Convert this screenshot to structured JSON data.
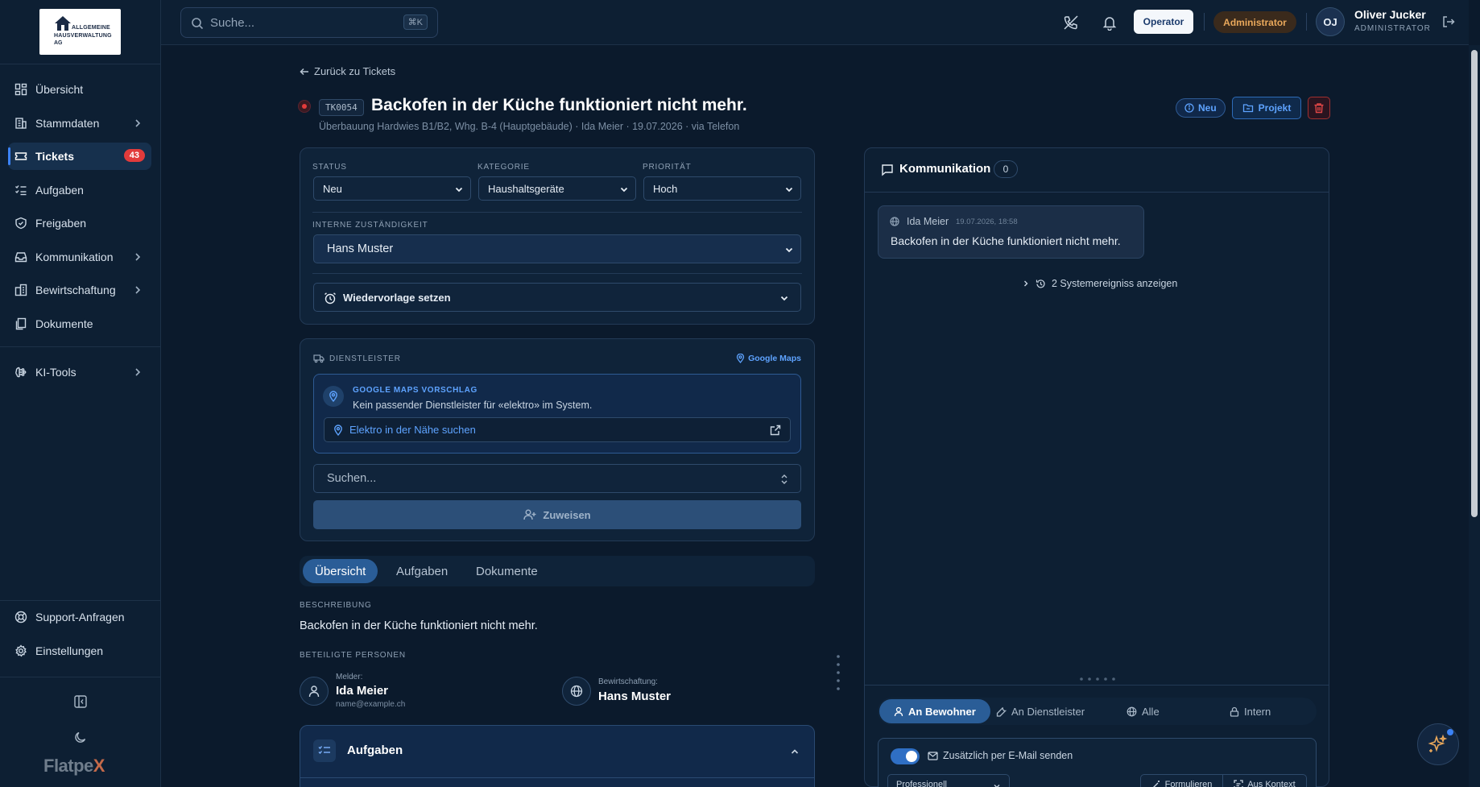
{
  "logo": {
    "line1": "ALLGEMEINE",
    "line2": "HAUSVERWALTUNG",
    "line3": "AG"
  },
  "sidebar": {
    "items": [
      {
        "label": "Übersicht"
      },
      {
        "label": "Stammdaten"
      },
      {
        "label": "Tickets",
        "badge": "43"
      },
      {
        "label": "Aufgaben"
      },
      {
        "label": "Freigaben"
      },
      {
        "label": "Kommunikation"
      },
      {
        "label": "Bewirtschaftung"
      },
      {
        "label": "Dokumente"
      },
      {
        "label": "KI-Tools"
      }
    ],
    "bottom": [
      {
        "label": "Support-Anfragen"
      },
      {
        "label": "Einstellungen"
      }
    ],
    "brand_main": "Flatpe",
    "brand_x": "X"
  },
  "topbar": {
    "search_placeholder": "Suche...",
    "search_shortcut": "⌘K",
    "operator_label": "Operator",
    "admin_label": "Administrator",
    "avatar_initials": "OJ",
    "user_name": "Oliver Jucker",
    "user_role": "ADMINISTRATOR"
  },
  "ticket": {
    "back_label": "Zurück zu Tickets",
    "id": "TK0054",
    "title": "Backofen in der Küche funktioniert nicht mehr.",
    "subtitle": "Überbauung Hardwies B1/B2, Whg. B-4 (Hauptgebäude) · Ida Meier · 19.07.2026 · via Telefon",
    "status_badge": "Neu",
    "project_label": "Projekt"
  },
  "details": {
    "status_label": "STATUS",
    "status_value": "Neu",
    "category_label": "KATEGORIE",
    "category_value": "Haushaltsgeräte",
    "priority_label": "PRIORITÄT",
    "priority_value": "Hoch",
    "responsible_label": "INTERNE ZUSTÄNDIGKEIT",
    "responsible_value": "Hans Muster",
    "followup_label": "Wiedervorlage setzen"
  },
  "provider": {
    "section_label": "DIENSTLEISTER",
    "maps_link": "Google Maps",
    "suggestion_title": "GOOGLE MAPS VORSCHLAG",
    "suggestion_text": "Kein passender Dienstleister für «elektro» im System.",
    "search_nearby": "Elektro in der Nähe suchen",
    "search_placeholder": "Suchen...",
    "assign_label": "Zuweisen"
  },
  "tabs": [
    "Übersicht",
    "Aufgaben",
    "Dokumente"
  ],
  "overview": {
    "description_label": "BESCHREIBUNG",
    "description": "Backofen in der Küche funktioniert nicht mehr.",
    "people_label": "BETEILIGTE PERSONEN",
    "reporter_role": "Melder:",
    "reporter_name": "Ida Meier",
    "reporter_email": "name@example.ch",
    "manager_role": "Bewirtschaftung:",
    "manager_name": "Hans Muster",
    "tasks_title": "Aufgaben"
  },
  "communication": {
    "title": "Kommunikation",
    "count": "0",
    "message_author": "Ida Meier",
    "message_time": "19.07.2026, 18:58",
    "message_text": "Backofen in der Küche funktioniert nicht mehr.",
    "system_events": "2 Systemereigniss anzeigen",
    "segments": [
      "An Bewohner",
      "An Dienstleister",
      "Alle",
      "Intern"
    ],
    "email_toggle_label": "Zusätzlich per E-Mail senden",
    "tone_value": "Professionell",
    "formulate_label": "Formulieren",
    "context_label": "Aus Kontext"
  },
  "colors": {
    "accent": "#2a5d97",
    "danger": "#e23b3b",
    "admin": "#e9a85b"
  }
}
